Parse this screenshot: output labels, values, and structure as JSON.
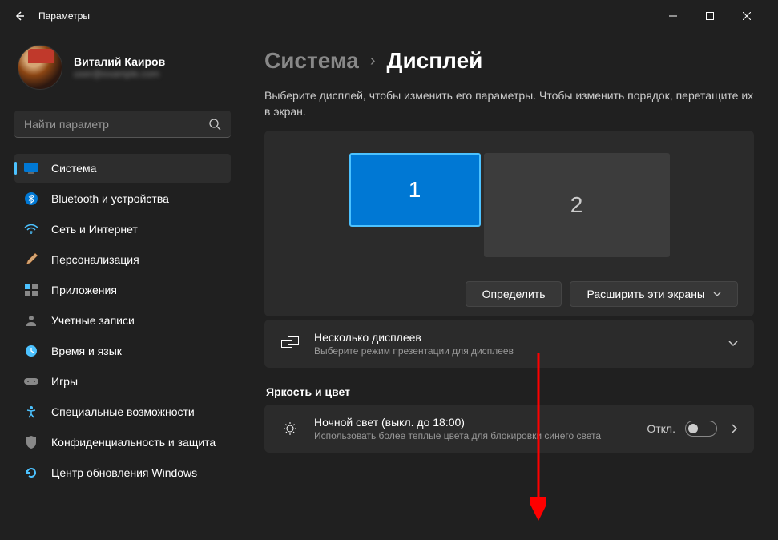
{
  "titlebar": {
    "title": "Параметры"
  },
  "user": {
    "name": "Виталий Каиров",
    "email": "user@example.com"
  },
  "search": {
    "placeholder": "Найти параметр"
  },
  "nav": [
    {
      "label": "Система",
      "icon": "system"
    },
    {
      "label": "Bluetooth и устройства",
      "icon": "bluetooth"
    },
    {
      "label": "Сеть и Интернет",
      "icon": "wifi"
    },
    {
      "label": "Персонализация",
      "icon": "personalization"
    },
    {
      "label": "Приложения",
      "icon": "apps"
    },
    {
      "label": "Учетные записи",
      "icon": "accounts"
    },
    {
      "label": "Время и язык",
      "icon": "time"
    },
    {
      "label": "Игры",
      "icon": "gaming"
    },
    {
      "label": "Специальные возможности",
      "icon": "accessibility"
    },
    {
      "label": "Конфиденциальность и защита",
      "icon": "privacy"
    },
    {
      "label": "Центр обновления Windows",
      "icon": "update"
    }
  ],
  "breadcrumb": {
    "parent": "Система",
    "current": "Дисплей"
  },
  "help_text": "Выберите дисплей, чтобы изменить его параметры. Чтобы изменить порядок, перетащите их в экран.",
  "monitors": {
    "m1": "1",
    "m2": "2"
  },
  "actions": {
    "identify": "Определить",
    "extend": "Расширить эти экраны"
  },
  "multi_displays": {
    "title": "Несколько дисплеев",
    "desc": "Выберите режим презентации для дисплеев"
  },
  "section_brightness": "Яркость и цвет",
  "night_light": {
    "title": "Ночной свет (выкл. до 18:00)",
    "desc": "Использовать более теплые цвета для блокировки синего света",
    "state": "Откл."
  }
}
